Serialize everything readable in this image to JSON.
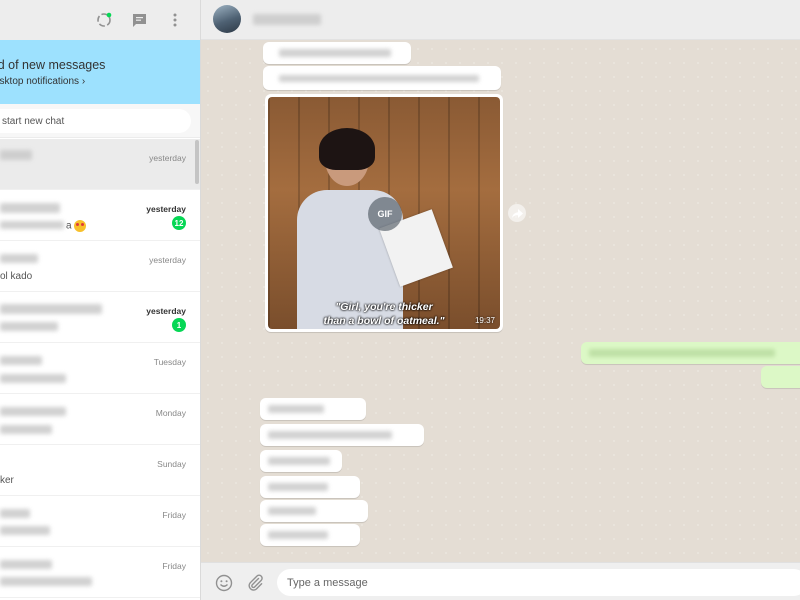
{
  "left_header": {
    "icons": [
      "status-icon",
      "new-chat-icon",
      "menu-icon"
    ]
  },
  "notification": {
    "title": "ied of new messages",
    "link": "esktop notifications ›"
  },
  "search": {
    "placeholder": "start new chat"
  },
  "chats": [
    {
      "time": "yesterday",
      "unread": false,
      "preview": "",
      "badge": ""
    },
    {
      "time": "yesterday",
      "unread": true,
      "preview": "a",
      "emoji": "heart-eyes-emoji",
      "badge": "12"
    },
    {
      "time": "yesterday",
      "unread": false,
      "preview": "ol kado",
      "badge": ""
    },
    {
      "time": "yesterday",
      "unread": true,
      "preview": "",
      "badge": "1"
    },
    {
      "time": "Tuesday",
      "unread": false,
      "preview": "",
      "badge": ""
    },
    {
      "time": "Monday",
      "unread": false,
      "preview": "",
      "badge": ""
    },
    {
      "time": "Sunday",
      "unread": false,
      "preview": "ker",
      "badge": ""
    },
    {
      "time": "Friday",
      "unread": false,
      "preview": "",
      "badge": ""
    },
    {
      "time": "Friday",
      "unread": false,
      "preview": "",
      "badge": ""
    }
  ],
  "conversation": {
    "gif": {
      "badge": "GIF",
      "caption_line1": "\"Girl, you're thicker",
      "caption_line2": "than a bowl of oatmeal.\"",
      "time": "19:37"
    }
  },
  "composer": {
    "placeholder": "Type a message"
  },
  "colors": {
    "notification_bg": "#9de1fe",
    "unread_badge": "#06d755",
    "outgoing_bubble": "#dcf8c6",
    "chat_bg": "#e4ddd4"
  }
}
